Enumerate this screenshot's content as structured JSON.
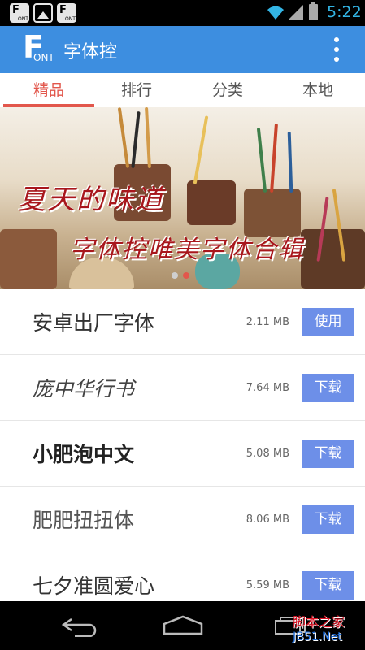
{
  "status_bar": {
    "time": "5:22",
    "notification_icons": [
      "font-app-icon",
      "image-icon",
      "font-app-icon"
    ],
    "accent_color": "#33b5e5"
  },
  "app_bar": {
    "logo_big": "F",
    "logo_small": "ONT",
    "title": "字体控",
    "overflow_icon": "more-vert-icon",
    "background": "#3d8ee0"
  },
  "tabs": [
    {
      "label": "精品",
      "active": true
    },
    {
      "label": "排行",
      "active": false
    },
    {
      "label": "分类",
      "active": false
    },
    {
      "label": "本地",
      "active": false
    }
  ],
  "banner": {
    "line1": "夏天的味道",
    "line2": "字体控唯美字体合辑",
    "page_count": 2,
    "current_page": 2
  },
  "fonts": [
    {
      "name": "安卓出厂字体",
      "size": "2.11 MB",
      "action": "使用",
      "style": "round"
    },
    {
      "name": "庞中华行书",
      "size": "7.64 MB",
      "action": "下载",
      "style": "serif"
    },
    {
      "name": "小肥泡中文",
      "size": "5.08 MB",
      "action": "下载",
      "style": "bold"
    },
    {
      "name": "肥肥扭扭体",
      "size": "8.06 MB",
      "action": "下载",
      "style": "thin"
    },
    {
      "name": "七夕准圆爱心",
      "size": "5.59 MB",
      "action": "下载",
      "style": "round"
    }
  ],
  "watermark": {
    "line1": "脚本之家",
    "line2": "JB51.Net"
  },
  "colors": {
    "tab_active": "#e2574c",
    "button": "#6d8fe8"
  }
}
